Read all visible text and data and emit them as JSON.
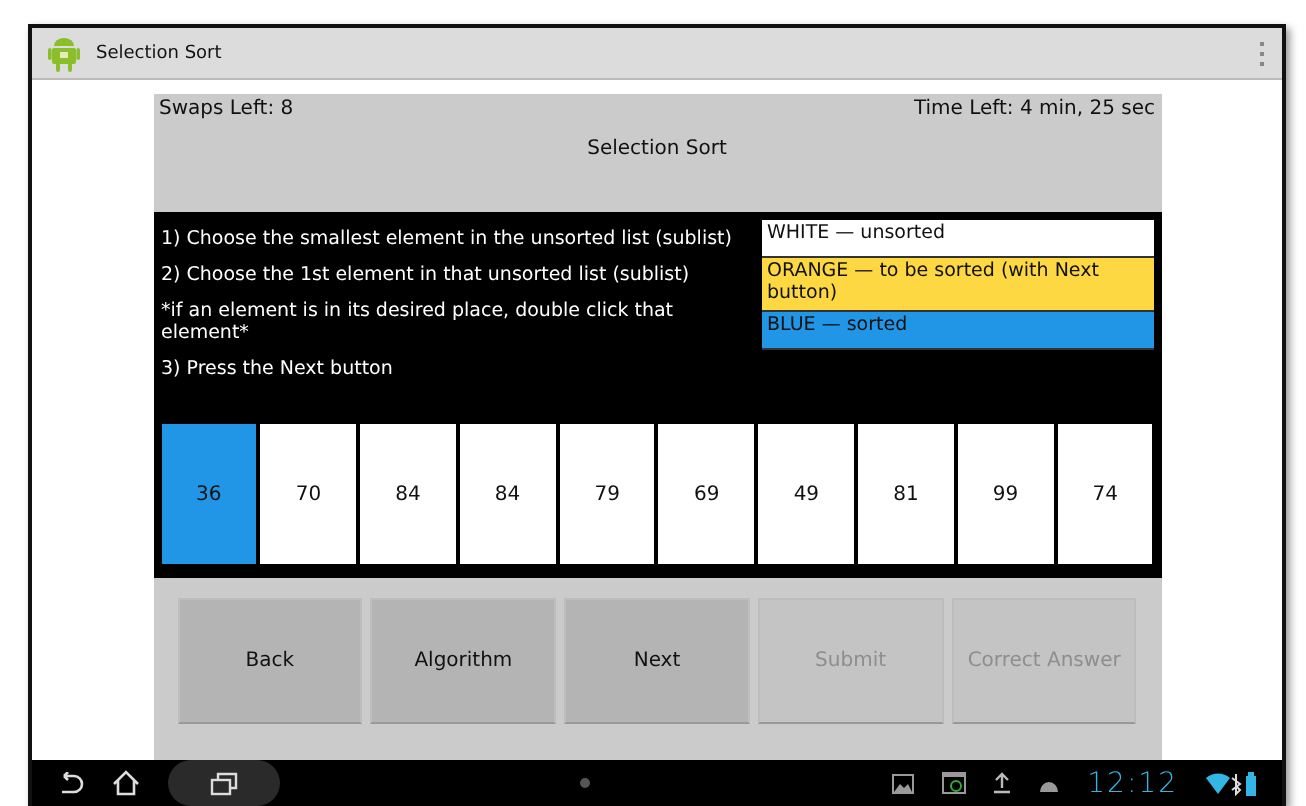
{
  "app_bar": {
    "title": "Selection Sort"
  },
  "header": {
    "swaps": "Swaps Left: 8",
    "time": "Time Left: 4 min, 25 sec",
    "title": "Selection Sort"
  },
  "instructions": [
    "1) Choose the smallest element in the unsorted list (sublist)",
    "2) Choose the 1st element in that unsorted list (sublist)",
    "*if an element is in its desired place, double click that element*",
    "3) Press the Next button"
  ],
  "legend": [
    {
      "label": "WHITE — unsorted",
      "color": "#ffffff"
    },
    {
      "label": "ORANGE — to be sorted (with Next button)",
      "color": "#fdd843"
    },
    {
      "label": "BLUE — sorted",
      "color": "#2296e6"
    }
  ],
  "cells": [
    {
      "value": "36",
      "color": "#2296e6"
    },
    {
      "value": "70",
      "color": "#ffffff"
    },
    {
      "value": "84",
      "color": "#ffffff"
    },
    {
      "value": "84",
      "color": "#ffffff"
    },
    {
      "value": "79",
      "color": "#ffffff"
    },
    {
      "value": "69",
      "color": "#ffffff"
    },
    {
      "value": "49",
      "color": "#ffffff"
    },
    {
      "value": "81",
      "color": "#ffffff"
    },
    {
      "value": "99",
      "color": "#ffffff"
    },
    {
      "value": "74",
      "color": "#ffffff"
    }
  ],
  "buttons": [
    {
      "label": "Back",
      "disabled": false
    },
    {
      "label": "Algorithm",
      "disabled": false
    },
    {
      "label": "Next",
      "disabled": false
    },
    {
      "label": "Submit",
      "disabled": true
    },
    {
      "label": "Correct Answer",
      "disabled": true
    }
  ],
  "status_bar": {
    "time": "12:12"
  }
}
